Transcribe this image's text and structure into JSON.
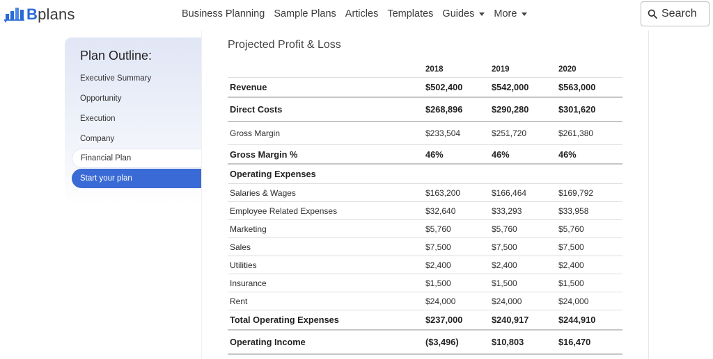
{
  "header": {
    "logo_text": "plans",
    "logo_letter": "B",
    "nav": [
      {
        "label": "Business Planning",
        "dropdown": false
      },
      {
        "label": "Sample Plans",
        "dropdown": false
      },
      {
        "label": "Articles",
        "dropdown": false
      },
      {
        "label": "Templates",
        "dropdown": false
      },
      {
        "label": "Guides",
        "dropdown": true
      },
      {
        "label": "More",
        "dropdown": true
      }
    ],
    "search_label": "Search"
  },
  "sidebar": {
    "title": "Plan Outline:",
    "items": [
      {
        "label": "Executive Summary",
        "state": "normal"
      },
      {
        "label": "Opportunity",
        "state": "normal"
      },
      {
        "label": "Execution",
        "state": "normal"
      },
      {
        "label": "Company",
        "state": "normal"
      },
      {
        "label": "Financial Plan",
        "state": "selected"
      },
      {
        "label": "Start your plan",
        "state": "primary"
      }
    ]
  },
  "main": {
    "section_title": "Projected Profit & Loss",
    "table": {
      "columns": [
        "",
        "2018",
        "2019",
        "2020"
      ],
      "rows": [
        {
          "label": "Revenue",
          "values": [
            "$502,400",
            "$542,000",
            "$563,000"
          ],
          "bold": true,
          "thick": true
        },
        {
          "label": "Direct Costs",
          "values": [
            "$268,896",
            "$290,280",
            "$301,620"
          ],
          "bold": true,
          "thick": true
        },
        {
          "label": "Gross Margin",
          "values": [
            "$233,504",
            "$251,720",
            "$261,380"
          ],
          "bold": false,
          "thick": false
        },
        {
          "label": "Gross Margin %",
          "values": [
            "46%",
            "46%",
            "46%"
          ],
          "bold": true,
          "thick": true
        },
        {
          "label": "Operating Expenses",
          "values": [
            "",
            "",
            ""
          ],
          "bold": true,
          "thick": false
        },
        {
          "label": "Salaries & Wages",
          "values": [
            "$163,200",
            "$166,464",
            "$169,792"
          ],
          "bold": false,
          "thick": false
        },
        {
          "label": "Employee Related Expenses",
          "values": [
            "$32,640",
            "$33,293",
            "$33,958"
          ],
          "bold": false,
          "thick": false
        },
        {
          "label": "Marketing",
          "values": [
            "$5,760",
            "$5,760",
            "$5,760"
          ],
          "bold": false,
          "thick": false
        },
        {
          "label": "Sales",
          "values": [
            "$7,500",
            "$7,500",
            "$7,500"
          ],
          "bold": false,
          "thick": false
        },
        {
          "label": "Utilities",
          "values": [
            "$2,400",
            "$2,400",
            "$2,400"
          ],
          "bold": false,
          "thick": false
        },
        {
          "label": "Insurance",
          "values": [
            "$1,500",
            "$1,500",
            "$1,500"
          ],
          "bold": false,
          "thick": false
        },
        {
          "label": "Rent",
          "values": [
            "$24,000",
            "$24,000",
            "$24,000"
          ],
          "bold": false,
          "thick": false
        },
        {
          "label": "Total Operating Expenses",
          "values": [
            "$237,000",
            "$240,917",
            "$244,910"
          ],
          "bold": true,
          "thick": true
        },
        {
          "label": "Operating Income",
          "values": [
            "($3,496)",
            "$10,803",
            "$16,470"
          ],
          "bold": true,
          "thick": true
        }
      ]
    }
  },
  "colors": {
    "brand_blue": "#2a6ad6",
    "primary_button": "#3a6ad5",
    "sidebar_tint": "#e1e6f6"
  }
}
